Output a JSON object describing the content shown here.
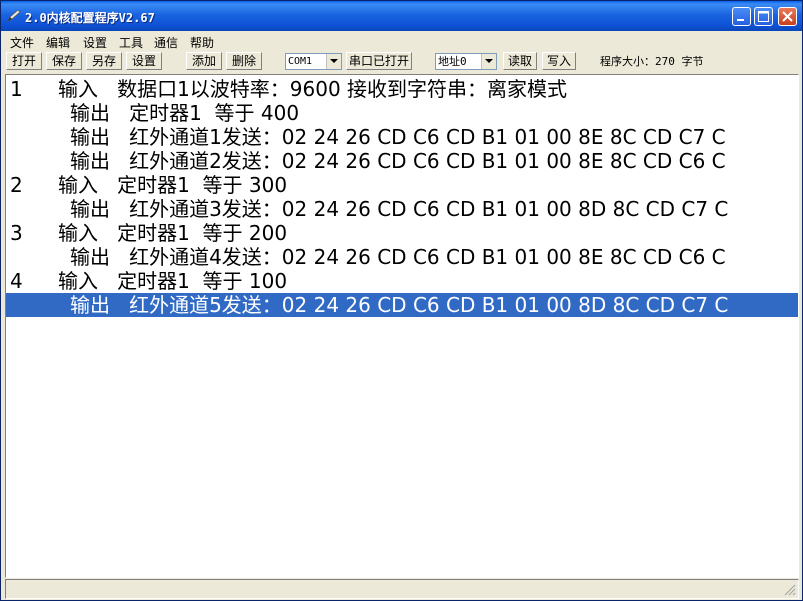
{
  "window": {
    "title": "2.0内核配置程序V2.67"
  },
  "menu": [
    "文件",
    "编辑",
    "设置",
    "工具",
    "通信",
    "帮助"
  ],
  "toolbar": {
    "buttons": [
      "打开",
      "保存",
      "另存",
      "设置",
      "添加",
      "删除"
    ],
    "port_select": "COM1",
    "port_status_button": "串口已打开",
    "address_select": "地址0",
    "read_button": "读取",
    "write_button": "写入",
    "program_size": "程序大小：270 字节"
  },
  "lines": [
    {
      "num": "1",
      "text": "输入   数据口1以波特率：9600 接收到字符串：离家模式"
    },
    {
      "num": "",
      "text": "输出   定时器1  等于 400"
    },
    {
      "num": "",
      "text": "输出   红外通道1发送：02 24 26 CD C6 CD B1 01 00 8E 8C CD C7 C"
    },
    {
      "num": "",
      "text": "输出   红外通道2发送：02 24 26 CD C6 CD B1 01 00 8E 8C CD C6 C"
    },
    {
      "num": "2",
      "text": "输入   定时器1  等于 300"
    },
    {
      "num": "",
      "text": "输出   红外通道3发送：02 24 26 CD C6 CD B1 01 00 8D 8C CD C7 C"
    },
    {
      "num": "3",
      "text": "输入   定时器1  等于 200"
    },
    {
      "num": "",
      "text": "输出   红外通道4发送：02 24 26 CD C6 CD B1 01 00 8E 8C CD C6 C"
    },
    {
      "num": "4",
      "text": "输入   定时器1  等于 100"
    },
    {
      "num": "",
      "text": "输出   红外通道5发送：02 24 26 CD C6 CD B1 01 00 8D 8C CD C7 C",
      "selected": true
    }
  ],
  "colors": {
    "selection": "#316AC5",
    "titlebar": "#0A5EE8"
  },
  "icons": {
    "app": "pencil-icon",
    "minimize": "minimize-icon",
    "maximize": "maximize-icon",
    "close": "close-icon"
  }
}
